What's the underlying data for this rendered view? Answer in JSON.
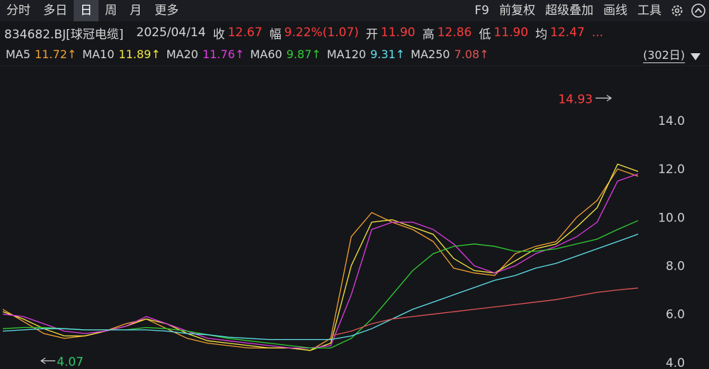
{
  "tabs": [
    "分时",
    "多日",
    "日",
    "周",
    "月",
    "更多"
  ],
  "active_tab": "日",
  "right_tools": [
    "F9",
    "前复权",
    "超级叠加",
    "画线",
    "工具"
  ],
  "info": {
    "code": "834682.BJ[球冠电缆]",
    "date": "2025/04/14",
    "close_label": "收",
    "close": "12.67",
    "amp_label": "幅",
    "amp": "9.22%(1.07)",
    "open_label": "开",
    "open": "11.90",
    "high_label": "高",
    "high": "12.86",
    "low_label": "低",
    "low": "11.90",
    "avg_label": "均",
    "avg": "12.47",
    "more": "..."
  },
  "ma": [
    {
      "label": "MA5",
      "value": "11.72↑",
      "color": "#f0a030"
    },
    {
      "label": "MA10",
      "value": "11.89↑",
      "color": "#f5e642"
    },
    {
      "label": "MA20",
      "value": "11.76↑",
      "color": "#e03ce0"
    },
    {
      "label": "MA60",
      "value": "9.87↑",
      "color": "#33cc33"
    },
    {
      "label": "MA120",
      "value": "9.31↑",
      "color": "#5fe0e8"
    },
    {
      "label": "MA250",
      "value": "7.08↑",
      "color": "#e05555"
    }
  ],
  "days_label": "(302日)",
  "chart_data": {
    "type": "line",
    "yticks": [
      4.0,
      6.0,
      8.0,
      10.0,
      12.0,
      14.0
    ],
    "ytick_labels": [
      "4.0",
      "6.0",
      "8.0",
      "10.0",
      "12.0",
      "14.0"
    ],
    "ylim": [
      3.85,
      15.7
    ],
    "max_label": "14.93",
    "min_label": "4.07",
    "series": [
      {
        "name": "MA5",
        "color": "#f0a030",
        "values": [
          6.2,
          5.7,
          5.2,
          5.0,
          5.1,
          5.3,
          5.6,
          5.8,
          5.4,
          5.0,
          4.8,
          4.7,
          4.6,
          4.6,
          4.6,
          4.5,
          5.0,
          9.2,
          10.2,
          9.8,
          9.5,
          9.0,
          7.9,
          7.7,
          7.6,
          8.5,
          8.8,
          9.0,
          10.0,
          10.7,
          12.0,
          11.7
        ]
      },
      {
        "name": "MA10",
        "color": "#f5e642",
        "values": [
          6.1,
          5.8,
          5.4,
          5.1,
          5.1,
          5.3,
          5.5,
          5.8,
          5.6,
          5.2,
          4.9,
          4.8,
          4.7,
          4.6,
          4.6,
          4.5,
          4.8,
          8.0,
          9.8,
          9.9,
          9.6,
          9.3,
          8.3,
          7.8,
          7.7,
          8.2,
          8.7,
          8.9,
          9.6,
          10.4,
          12.2,
          11.9
        ]
      },
      {
        "name": "MA20",
        "color": "#e03ce0",
        "values": [
          6.0,
          5.9,
          5.6,
          5.3,
          5.2,
          5.3,
          5.5,
          5.9,
          5.6,
          5.3,
          5.0,
          4.9,
          4.8,
          4.7,
          4.6,
          4.6,
          4.7,
          6.8,
          9.5,
          9.8,
          9.8,
          9.5,
          8.9,
          8.0,
          7.7,
          8.0,
          8.5,
          8.8,
          9.2,
          9.8,
          11.5,
          11.8
        ]
      },
      {
        "name": "MA60",
        "color": "#33cc33",
        "values": [
          5.4,
          5.45,
          5.45,
          5.4,
          5.35,
          5.35,
          5.35,
          5.45,
          5.4,
          5.3,
          5.15,
          5.0,
          4.9,
          4.8,
          4.7,
          4.6,
          4.6,
          5.0,
          5.8,
          6.8,
          7.8,
          8.5,
          8.8,
          8.9,
          8.8,
          8.6,
          8.6,
          8.7,
          8.9,
          9.1,
          9.5,
          9.87
        ]
      },
      {
        "name": "MA120",
        "color": "#5fe0e8",
        "values": [
          5.3,
          5.35,
          5.4,
          5.4,
          5.35,
          5.35,
          5.35,
          5.35,
          5.3,
          5.2,
          5.15,
          5.05,
          5.0,
          4.95,
          4.95,
          4.95,
          4.95,
          5.1,
          5.4,
          5.8,
          6.2,
          6.5,
          6.8,
          7.1,
          7.4,
          7.6,
          7.9,
          8.1,
          8.4,
          8.7,
          9.0,
          9.31
        ]
      },
      {
        "name": "MA250",
        "color": "#e05555",
        "values": [
          null,
          null,
          null,
          null,
          null,
          null,
          null,
          null,
          null,
          null,
          null,
          null,
          null,
          null,
          null,
          null,
          5.1,
          5.3,
          5.6,
          5.8,
          5.9,
          6.0,
          6.1,
          6.2,
          6.3,
          6.4,
          6.5,
          6.6,
          6.75,
          6.9,
          7.0,
          7.08
        ]
      }
    ]
  }
}
